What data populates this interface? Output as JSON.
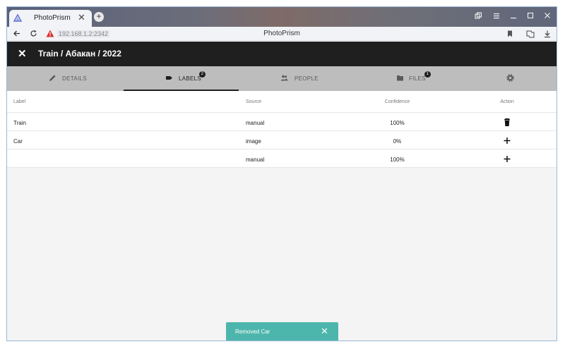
{
  "browser": {
    "tab_title": "PhotoPrism",
    "tab_close": "✕",
    "new_tab": "+",
    "url": "192.168.1.2:2342",
    "page_title": "PhotoPrism"
  },
  "app": {
    "title": "Train / Абакан / 2022",
    "close": "✕"
  },
  "tabs": [
    {
      "label": "DETAILS",
      "icon": "pencil-icon"
    },
    {
      "label": "LABELS",
      "icon": "label-icon",
      "badge": "2"
    },
    {
      "label": "PEOPLE",
      "icon": "people-icon"
    },
    {
      "label": "FILES",
      "icon": "folder-icon",
      "badge": "1"
    },
    {
      "label": "",
      "icon": "gear-icon"
    }
  ],
  "table": {
    "headers": {
      "label": "Label",
      "source": "Source",
      "confidence": "Confidence",
      "action": "Action"
    },
    "rows": [
      {
        "label": "Train",
        "source": "manual",
        "confidence": "100%",
        "action": "delete-icon"
      },
      {
        "label": "Car",
        "source": "image",
        "confidence": "0%",
        "action": "add-icon"
      },
      {
        "label": "",
        "source": "manual",
        "confidence": "100%",
        "action": "add-icon"
      }
    ]
  },
  "snackbar": {
    "message": "Removed Car",
    "close": "✕"
  },
  "colors": {
    "appbar": "#1f1f1f",
    "tabsbar": "#bdbdbd",
    "snackbar": "#4db6ac",
    "background": "#f4f4f4"
  }
}
